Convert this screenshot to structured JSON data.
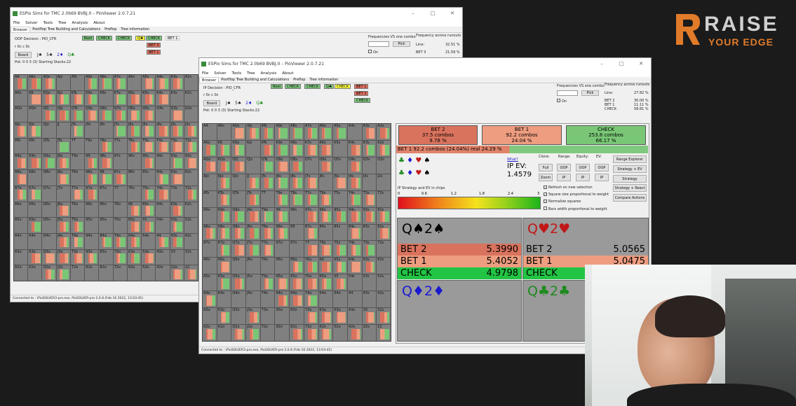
{
  "brand": {
    "line1": "RAISE",
    "line2": "YOUR EDGE",
    "accent": "#e07b2a"
  },
  "back_window": {
    "title": "ESPio Sims for TMC 2.0b69 BVBJ.0 – PioViewer 2.0.7.21",
    "menu": [
      "File",
      "Solver",
      "Tools",
      "Tree",
      "Analysis",
      "About"
    ],
    "tabs": [
      "Browser",
      "Postflop Tree Building and Calculations",
      "Preflop",
      "Tree information"
    ],
    "decision": "OOP Decision : PIO_CFR",
    "board_line": "r 0c c 0c",
    "board_button": "Board",
    "board_cards": [
      "J♠",
      "5♠",
      "2♦",
      "Q♣"
    ],
    "pot": "Pot: 0 0 3 (3) Starting Stacks:22",
    "actions_row1": [
      "Root",
      "CHECK",
      "CHECK",
      "Q♣",
      "CHECK",
      "BET 1"
    ],
    "actions_col": [
      "BET 3",
      "BET 1"
    ],
    "freq_label": "Frequencies VS one combo",
    "pick": "Pick",
    "on": "On",
    "runouts_label": "Frequency across runouts",
    "line_label": "Line:",
    "line_value": "32.51 %",
    "bet3_label": "BET 3",
    "bet3_value": "21.59 %",
    "status": "Connected to : \\PioSOLVER3-pro.exe, PioSOLVER-pro 2.0.8 (Feb 16 2022, 13:03:45)"
  },
  "front_window": {
    "title": "ESPio Sims for TMC 2.0b69 BVBJ.0 – PioViewer 2.0.7.21",
    "menu": [
      "File",
      "Solver",
      "Tools",
      "Tree",
      "Analysis",
      "About"
    ],
    "tabs": [
      "Browser",
      "Postflop Tree Building and Calculations",
      "Preflop",
      "Tree information"
    ],
    "decision": "IP Decision : PIO_CFR",
    "board_line": "r 0c c 0c",
    "board_button": "Board",
    "board_cards": [
      "J♠",
      "5♠",
      "2♦",
      "Q♣"
    ],
    "pot": "Pot: 0 0 3 (3) Starting Stacks:22",
    "actions_row1": [
      "Root",
      "CHECK",
      "CHECK",
      "Q♣",
      "CHECK",
      "BET 1"
    ],
    "actions_col": [
      "BET 2",
      "CHECK"
    ],
    "freq_label": "Frequencies VS one combo",
    "pick": "Pick",
    "on": "On",
    "runouts_label": "Frequency across runouts",
    "line_label": "Line:",
    "line_value": "27.82 %",
    "stats": [
      {
        "label": "BET 2",
        "value": "30.00 %"
      },
      {
        "label": "BET 1",
        "value": "11.11 %"
      },
      {
        "label": "CHECK",
        "value": "58.81 %"
      }
    ],
    "summary": [
      {
        "name": "BET 2",
        "combos": "37.5 combos",
        "pct": "9.78 %",
        "color": "#d9735e"
      },
      {
        "name": "BET 1",
        "combos": "92.2 combos",
        "pct": "24.04 %",
        "color": "#ee9d80"
      },
      {
        "name": "CHECK",
        "combos": "253.8 combos",
        "pct": "66.17 %",
        "color": "#79c776"
      }
    ],
    "selected_bar": "BET 1  92.2 combos (24.04%)  real  24.29 %",
    "what": "What?",
    "ip_ev_label": "IP EV:",
    "ip_ev_value": "1.4579",
    "suit_row1": [
      "♣",
      "♦",
      "♥",
      "♠"
    ],
    "suit_row2": [
      "♣",
      "♦",
      "♥",
      "♠"
    ],
    "scale_label": "IP Strategy and EV in chips",
    "scale_ticks": [
      "0",
      "0.6",
      "1.2",
      "1.8",
      "2.4",
      "3"
    ],
    "mode_headers": [
      "Clone:",
      "Range:",
      "Equity:",
      "EV:"
    ],
    "btn_full": "Full",
    "btn_zoom": "Zoom",
    "oop_labels": [
      "OOP",
      "OOP",
      "OOP"
    ],
    "ip_labels": [
      "IP",
      "IP",
      "IP"
    ],
    "right_buttons": [
      "Range Explorer",
      "Strategy + EV",
      "Strategy",
      "Strategy + React",
      "Compare Actions"
    ],
    "checks": [
      "Refresh on new selection",
      "Square size proportional to weight",
      "Normalize squares",
      "Bars width proportional to weight"
    ],
    "hands": [
      {
        "title": "Q♠2♠",
        "title_color": "#000",
        "rows": [
          {
            "a": "BET 2",
            "v": "5.3990"
          },
          {
            "a": "BET 1",
            "v": "5.4052"
          },
          {
            "a": "CHECK",
            "v": "4.9798"
          }
        ]
      },
      {
        "title": "Q♥2♥",
        "title_color": "#c01818",
        "rows": [
          {
            "a": "BET 2",
            "v": "5.0565"
          },
          {
            "a": "BET 1",
            "v": "5.0475"
          },
          {
            "a": "CHECK",
            "v": ""
          }
        ]
      },
      {
        "title": "Q♦2♦",
        "title_color": "#1a1ad0"
      },
      {
        "title": "Q♣2♣",
        "title_color": "#1e8a1e"
      }
    ],
    "status": "Connected to : \\PioSOLVER3-pro.exe, PioSOLVER-pro 2.0.8 (Feb 16 2022, 13:03:45)"
  },
  "grid_ranks": [
    "A",
    "K",
    "Q",
    "J",
    "T",
    "9",
    "8",
    "7",
    "6",
    "5",
    "4",
    "3",
    "2"
  ]
}
